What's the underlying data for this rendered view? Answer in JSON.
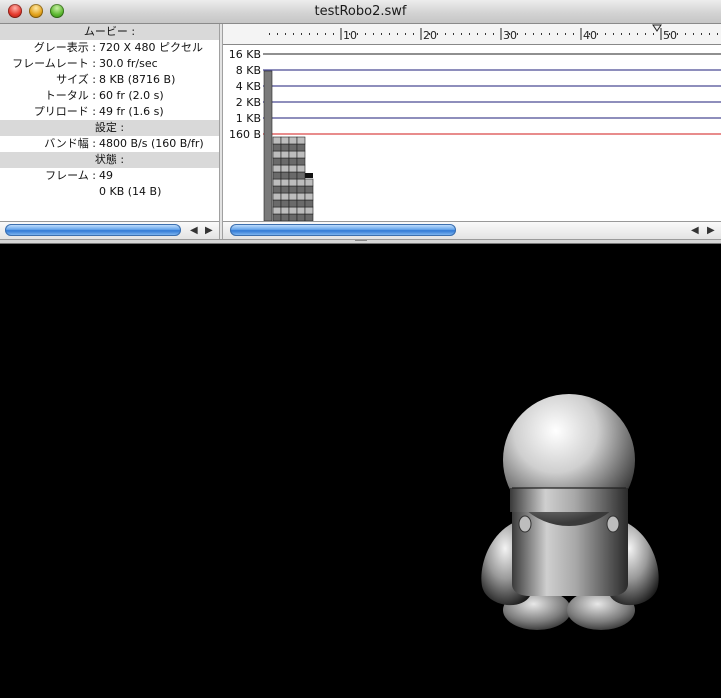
{
  "window": {
    "title": "testRobo2.swf"
  },
  "movie_info": {
    "header": "ムービー :",
    "rows": [
      {
        "label": "グレー表示 :",
        "value": "720 X 480 ピクセル"
      },
      {
        "label": "フレームレート :",
        "value": "30.0 fr/sec"
      },
      {
        "label": "サイズ :",
        "value": "8 KB (8716 B)"
      },
      {
        "label": "トータル :",
        "value": "60 fr (2.0 s)"
      },
      {
        "label": "プリロード :",
        "value": "49 fr (1.6 s)"
      }
    ],
    "settings_header": "設定 :",
    "settings_rows": [
      {
        "label": "バンド幅 :",
        "value": "4800 B/s (160 B/fr)"
      }
    ],
    "state_header": "状態 :",
    "state_rows": [
      {
        "label": "フレーム :",
        "value": "49"
      },
      {
        "label": "",
        "value": "0 KB (14 B)"
      }
    ]
  },
  "bandwidth_graph": {
    "size_labels": [
      "16 KB",
      "8 KB",
      "4 KB",
      "2 KB",
      "1 KB",
      "160 B"
    ],
    "ruler_numbers": [
      "10",
      "20",
      "30",
      "40",
      "50"
    ],
    "current_frame": 49,
    "colors": {
      "gridline": "#1c1c7a",
      "bandwidth_line": "#d21a1a"
    }
  }
}
